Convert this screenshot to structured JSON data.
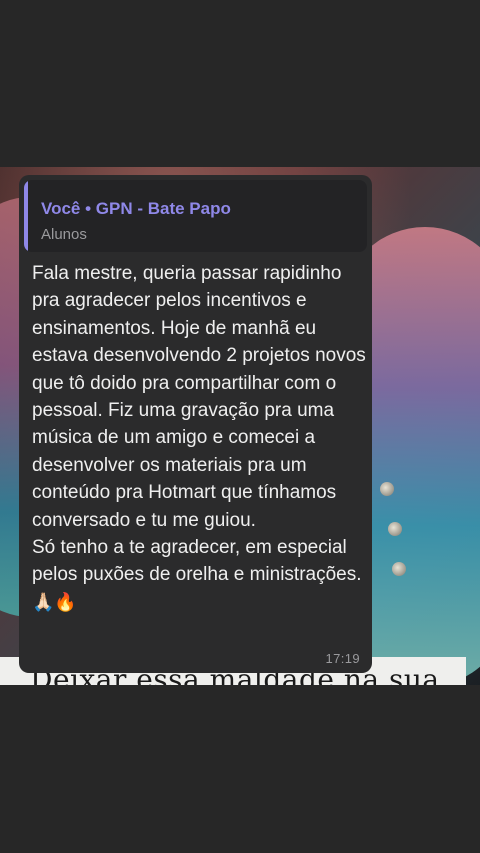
{
  "reply": {
    "title": "Você • GPN - Bate Papo",
    "subtitle": "Alunos"
  },
  "message": {
    "paragraph1": "Fala mestre, queria passar rapidinho pra agradecer pelos incentivos e ensinamentos. Hoje de manhã eu estava desenvolvendo 2 projetos novos que tô doido pra compartilhar com o pessoal. Fiz uma gravação pra uma música de um amigo e comecei a desenvolver os materiais pra um conteúdo pra Hotmart que tínhamos conversado e tu me guiou.",
    "paragraph2": "Só tenho a te agradecer, em especial pelos puxões de orelha e ministrações.",
    "emojis": "🙏🏻🔥",
    "time": "17:19"
  },
  "background": {
    "paper_text": "Deixar essa maldade na sua"
  },
  "colors": {
    "accent": "#8f88e8",
    "bubble": "#2b2b2c",
    "page": "#272727"
  }
}
